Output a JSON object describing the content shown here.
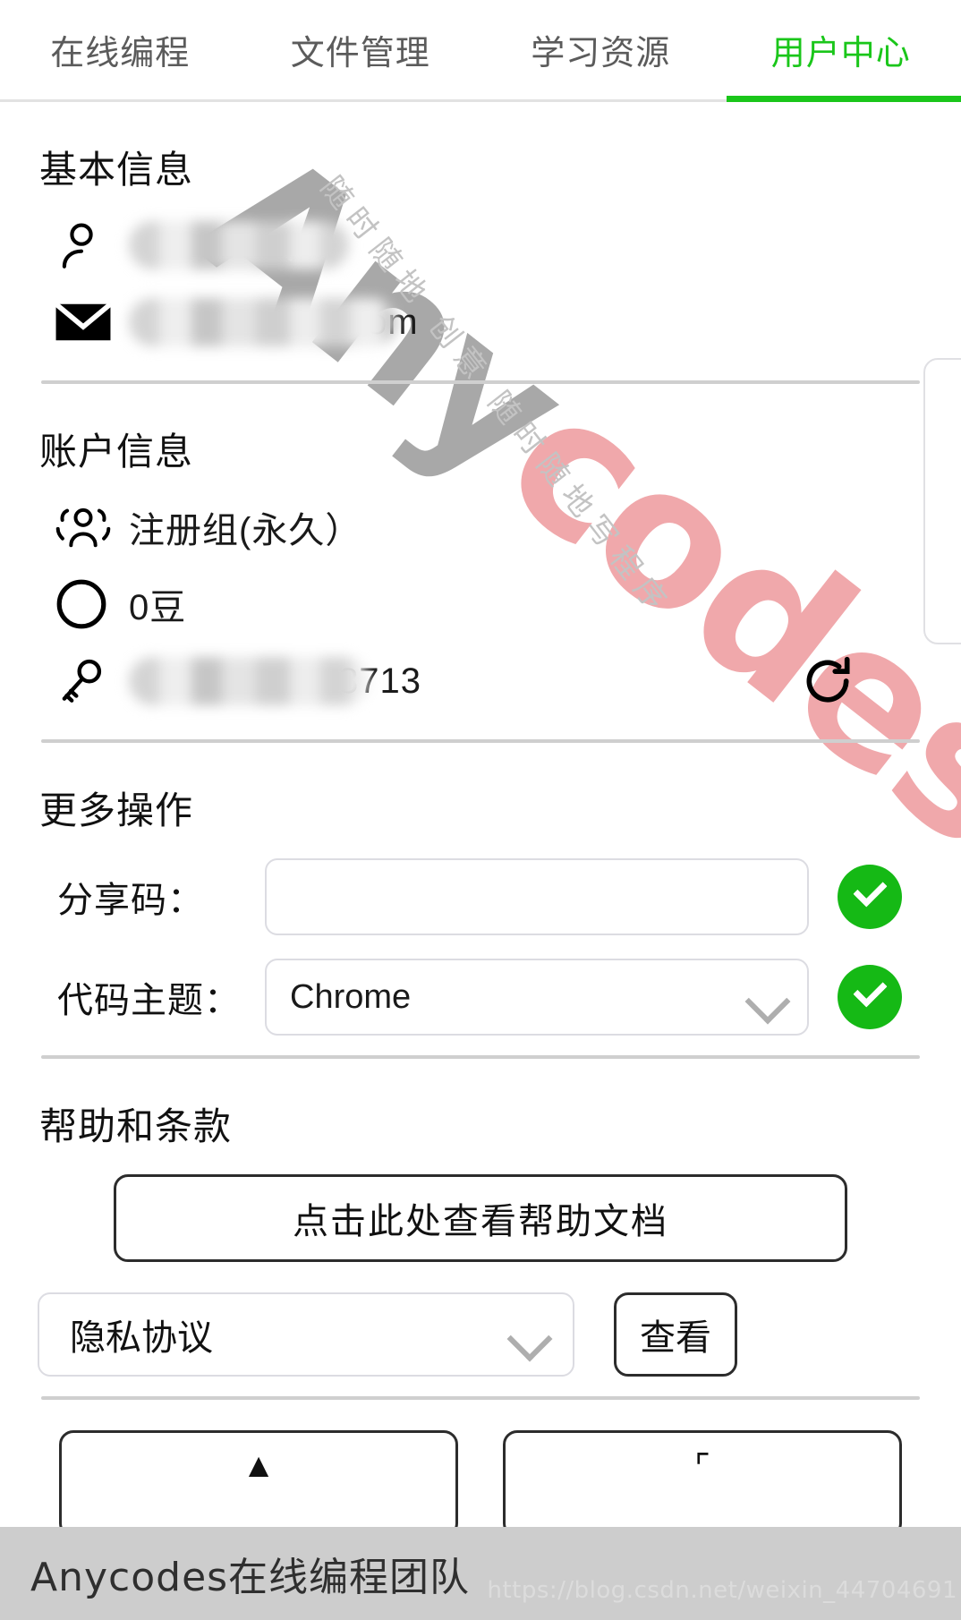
{
  "nav": {
    "tabs": [
      {
        "label": "在线编程",
        "active": false
      },
      {
        "label": "文件管理",
        "active": false
      },
      {
        "label": "学习资源",
        "active": false
      },
      {
        "label": "用户中心",
        "active": true
      }
    ],
    "active_color": "#1ac61a",
    "inactive_color": "#5b5b5b"
  },
  "watermark": {
    "brand_gray": "Any",
    "brand_pink": "codes",
    "cn_line_1": "随时随地 创意",
    "cn_line_2": "随时随地写程序",
    "gray_hex": "#a8a8a8",
    "pink_hex": "#f0a8ab"
  },
  "basic_info": {
    "title": "基本信息",
    "username_icon": "person-icon",
    "username_redacted": true,
    "email_icon": "envelope-icon",
    "email_tail": "om",
    "email_redacted": true
  },
  "account_info": {
    "title": "账户信息",
    "group_icon": "people-icon",
    "group_value": "注册组(永久）",
    "coins_icon": "circle-icon",
    "coins_value": "0豆",
    "key_icon": "key-icon",
    "key_tail": "8713",
    "key_redacted": true,
    "refresh_icon": "refresh-icon"
  },
  "more_actions": {
    "title": "更多操作",
    "share_code_label": "分享码：",
    "share_code_value": "",
    "share_code_placeholder": "",
    "share_code_confirm": "check-icon",
    "theme_label": "代码主题：",
    "theme_value": "Chrome",
    "theme_confirm": "check-icon"
  },
  "help_terms": {
    "title": "帮助和条款",
    "help_doc_button": "点击此处查看帮助文档",
    "terms_select_value": "隐私协议",
    "view_button": "查看"
  },
  "footer": {
    "team_text": "Anycodes在线编程团队",
    "csdn_watermark": "https://blog.csdn.net/weixin_44704691",
    "bar_color": "#cdcdcd"
  }
}
